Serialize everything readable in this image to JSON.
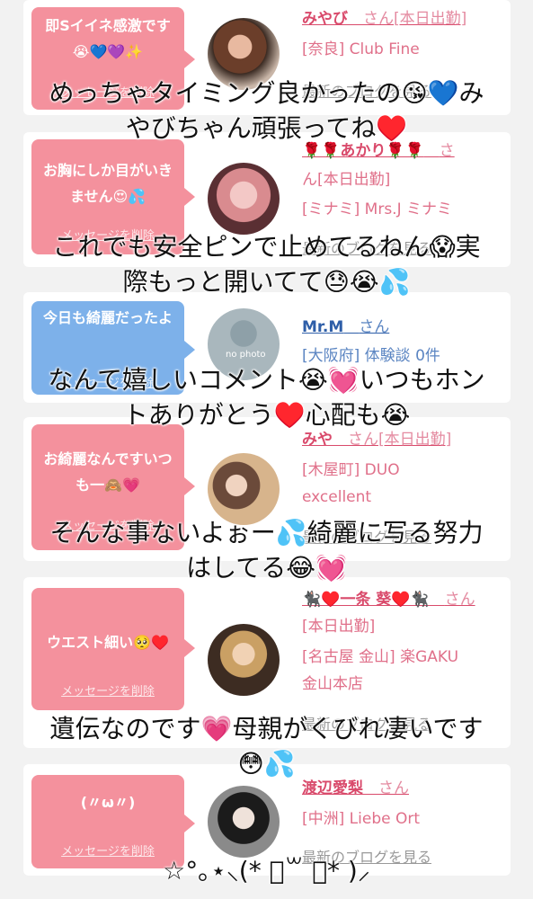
{
  "cards": [
    {
      "bubble": "即Sイイネ感激です😭💙💜✨",
      "delete": "メッセージを削除",
      "name": "みやび",
      "honorific": "さん[本日出勤]",
      "lines": [
        "[奈良] Club Fine"
      ],
      "blog": "最新のブログを見る"
    },
    {
      "bubble": "お胸にしか目がいきません😍💦",
      "delete": "メッセージを削除",
      "name": "🌹🌹あかり🌹🌹",
      "honorific": "さ",
      "lines": [
        "ん[本日出勤]",
        "[ミナミ] Mrs.J ミナミ"
      ],
      "blog": "最新のブログを見る"
    },
    {
      "bubble": "今日も綺麗だったよ",
      "delete": "メッセージを削除",
      "name": "Mr.M",
      "honorific": "さん",
      "lines": [
        "[大阪府] 体験談 0件"
      ],
      "avatar_text": "no photo"
    },
    {
      "bubble": "お綺麗なんですいつも一🙈💗",
      "delete": "メッセージを削除",
      "name": "みや",
      "honorific": "さん[本日出勤]",
      "lines": [
        "[木屋町] DUO",
        "excellent"
      ],
      "blog": "最新のブログを見る"
    },
    {
      "bubble": "ウエスト細い🥺♥️",
      "delete": "メッセージを削除",
      "name": "🐈‍⬛♥️一条 葵♥️🐈‍⬛",
      "honorific": "さん",
      "lines": [
        "[本日出勤]",
        "[名古屋 金山] 楽GAKU",
        "金山本店"
      ],
      "blog": "最新のブログを見る"
    },
    {
      "bubble": "(〃ω〃)",
      "delete": "メッセージを削除",
      "name": "渡辺愛梨",
      "honorific": "さん",
      "lines": [
        "[中洲] Liebe Ort"
      ],
      "blog": "最新のブログを見る"
    }
  ],
  "captions": [
    "めっちゃタイミング良かったの😘💙み",
    "やびちゃん頑張ってね♥️",
    "これでも安全ピンで止めてるねん😱実",
    "際もっと開いてて😓😭💦",
    "なんて嬉しいコメント😭💓いつもホン",
    "トありがとう♥️心配も😭",
    "そんな事ないよぉー💦綺麗に写る努力",
    "はしてる😂💓",
    "遺伝なのです💗母親がくびれ凄いです",
    "😳💦",
    "☆°｡⋆⸜(* ॑꒳ ॑*  )⸝"
  ]
}
